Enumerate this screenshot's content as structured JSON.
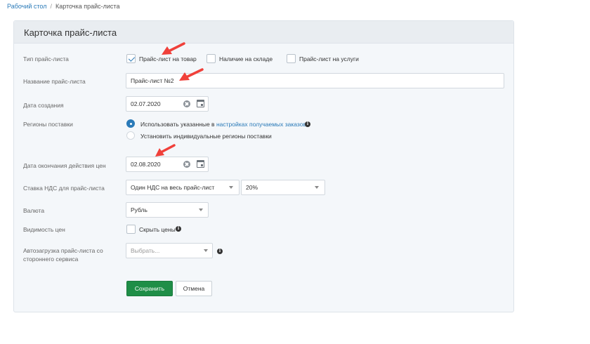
{
  "breadcrumb": {
    "home": "Рабочий стол",
    "current": "Карточка прайс-листа"
  },
  "card": {
    "title": "Карточка прайс-листа"
  },
  "form": {
    "type": {
      "label": "Тип прайс-листа",
      "options": [
        {
          "label": "Прайс-лист на товар",
          "checked": true
        },
        {
          "label": "Наличие на складе",
          "checked": false
        },
        {
          "label": "Прайс-лист на услуги",
          "checked": false
        }
      ]
    },
    "name": {
      "label": "Название прайс-листа",
      "value": "Прайс-лист №2"
    },
    "created": {
      "label": "Дата создания",
      "value": "02.07.2020"
    },
    "regions": {
      "label": "Регионы поставки",
      "option1_prefix": "Использовать указанные в",
      "option1_link": "настройках получаемых заказов",
      "option2": "Установить индивидуальные регионы поставки"
    },
    "end_date": {
      "label": "Дата окончания действия цен",
      "value": "02.08.2020"
    },
    "vat": {
      "label": "Ставка НДС для прайс-листа",
      "mode": "Один НДС на весь прайс-лист",
      "rate": "20%"
    },
    "currency": {
      "label": "Валюта",
      "value": "Рубль"
    },
    "visibility": {
      "label": "Видимость цен",
      "checkbox_label": "Скрыть цены"
    },
    "autoload": {
      "label_line1": "Автозагрузка прайс-листа со",
      "label_line2": "стороннего сервиса",
      "placeholder": "Выбрать..."
    }
  },
  "buttons": {
    "save": "Сохранить",
    "cancel": "Отмена"
  },
  "colors": {
    "accent": "#2a7ab8",
    "save_button": "#1f8e47",
    "annotation_arrow": "#f0403a"
  },
  "icons": {
    "check": "check-icon",
    "clear": "clear-circle-icon",
    "calendar": "calendar-icon",
    "info": "info-icon",
    "dropdown": "chevron-down-icon",
    "annotation": "red-arrow-icon"
  }
}
